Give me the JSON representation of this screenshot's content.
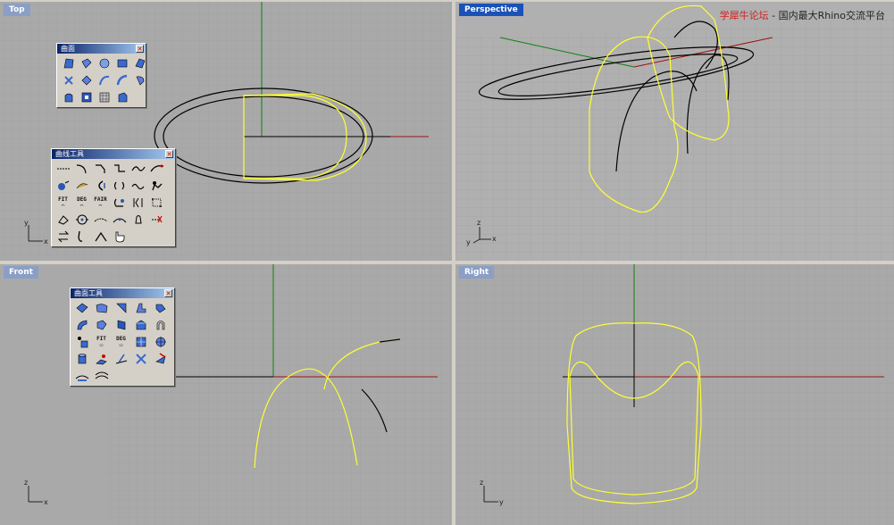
{
  "viewports": {
    "top": {
      "title": "Top",
      "active": false
    },
    "perspective": {
      "title": "Perspective",
      "active": true
    },
    "front": {
      "title": "Front",
      "active": false
    },
    "right": {
      "title": "Right",
      "active": false
    }
  },
  "watermark": {
    "brand": "学犀牛论坛",
    "separator": " - ",
    "slogan": "国内最大Rhino交流平台"
  },
  "axis_labels": {
    "x": "x",
    "y": "y",
    "z": "z"
  },
  "toolbars": {
    "surface_top": {
      "title": "曲面"
    },
    "curve_tools": {
      "title": "曲线工具",
      "fit_label": "FIT",
      "deg_label": "DEG",
      "fair_label": "FAIR"
    },
    "surface_tools": {
      "title": "曲面工具",
      "fit_label": "FIT",
      "deg_label": "DEG"
    }
  },
  "colors": {
    "grid_bg": "#a9a9a9",
    "grid_minor": "#9c9c9c",
    "grid_major": "#8c8c8c",
    "x_axis": "#a01010",
    "y_axis": "#108010",
    "curve_selected": "#ffff33",
    "curve": "#000000",
    "active_title": "#1a52b8",
    "inactive_title": "#8a9ec6"
  }
}
